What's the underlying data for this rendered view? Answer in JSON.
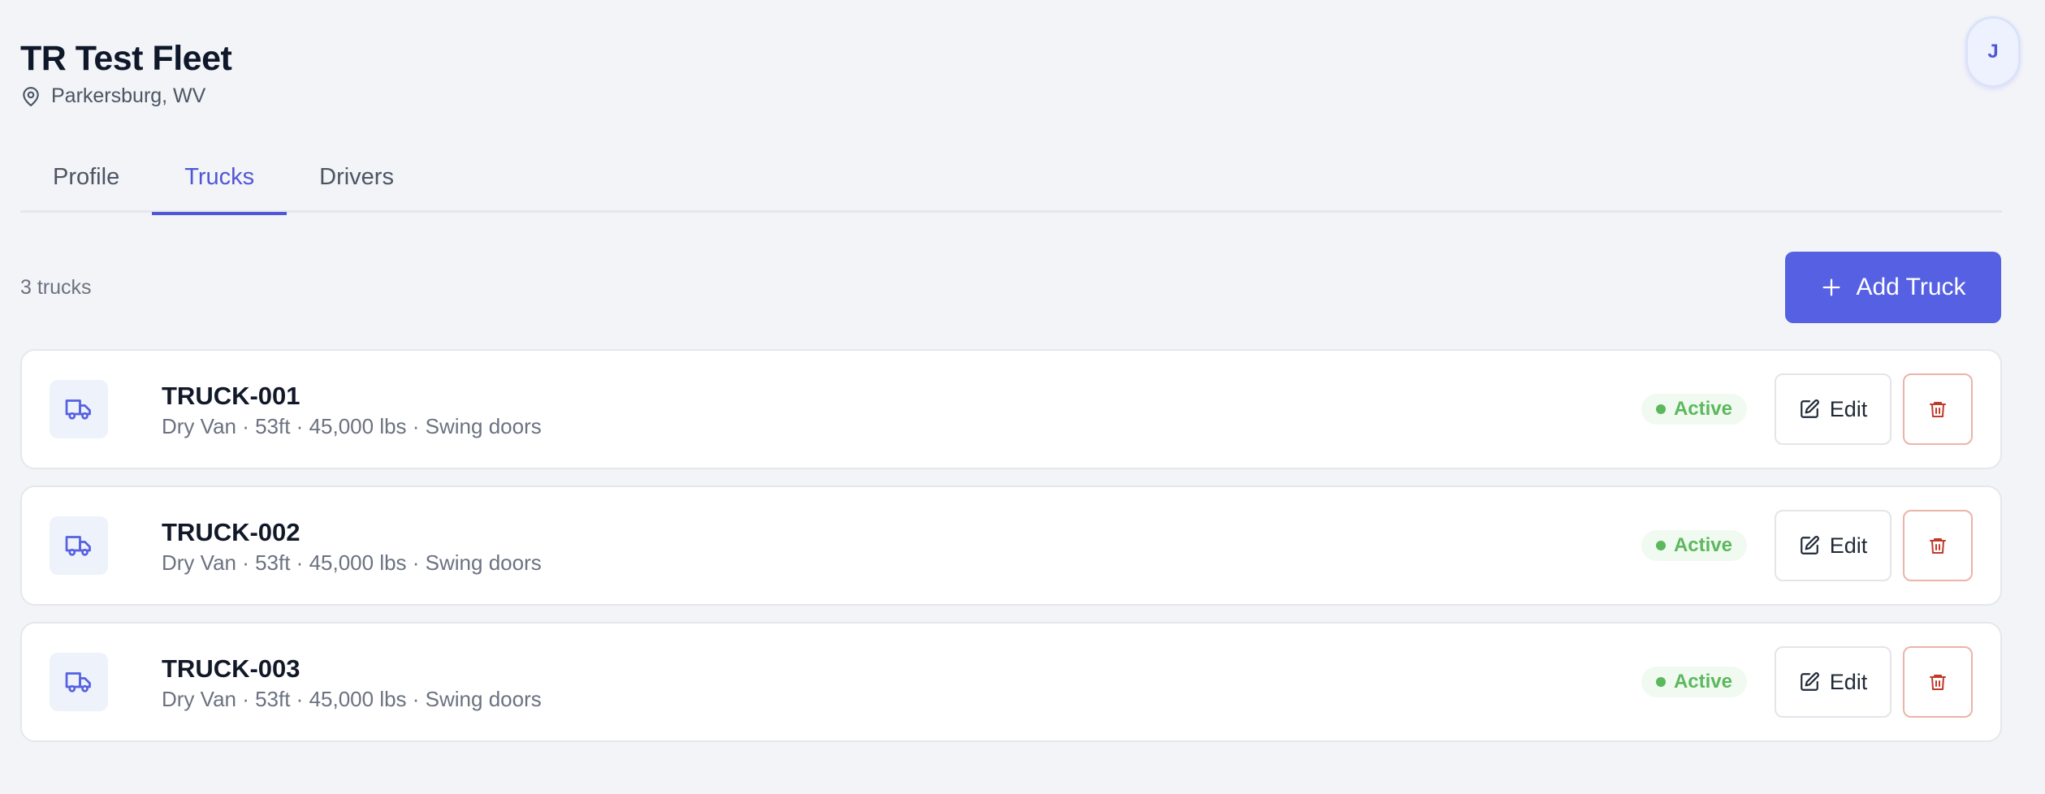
{
  "header": {
    "title": "TR Test Fleet",
    "location": "Parkersburg, WV",
    "location_icon": "map-pin-icon"
  },
  "user": {
    "avatar_initial": "J"
  },
  "tabs": [
    {
      "label": "Profile",
      "active": false
    },
    {
      "label": "Trucks",
      "active": true
    },
    {
      "label": "Drivers",
      "active": false
    }
  ],
  "trucks_section": {
    "count_label": "3 trucks",
    "add_button_label": "Add Truck",
    "add_button_icon": "plus-icon"
  },
  "trucks": [
    {
      "name": "TRUCK-001",
      "description": "Dry Van · 53ft · 45,000 lbs · Swing doors",
      "status": "Active",
      "edit_label": "Edit"
    },
    {
      "name": "TRUCK-002",
      "description": "Dry Van · 53ft · 45,000 lbs · Swing doors",
      "status": "Active",
      "edit_label": "Edit"
    },
    {
      "name": "TRUCK-003",
      "description": "Dry Van · 53ft · 45,000 lbs · Swing doors",
      "status": "Active",
      "edit_label": "Edit"
    }
  ],
  "colors": {
    "accent": "#5560e3",
    "active_tab": "#4f56d8",
    "status_active": "#5cb85c",
    "delete": "#c0392b"
  }
}
